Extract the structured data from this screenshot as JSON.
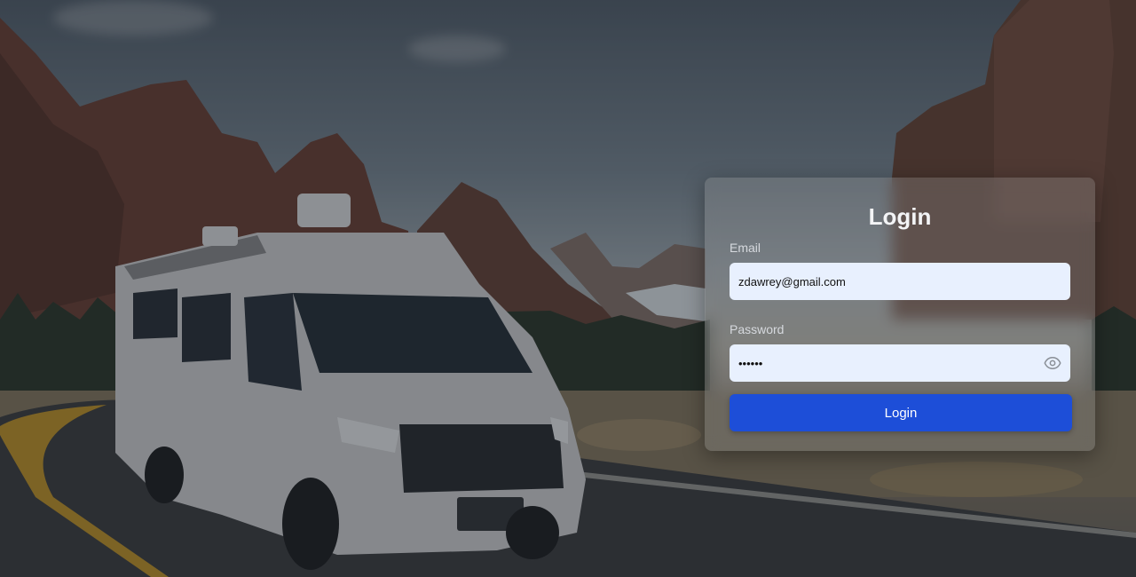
{
  "login": {
    "title": "Login",
    "email_label": "Email",
    "email_value": "zdawrey@gmail.com",
    "password_label": "Password",
    "password_value": "••••••",
    "submit_label": "Login",
    "toggle_icon": "eye-icon"
  },
  "colors": {
    "button": "#1d4ed8",
    "input_bg": "#e8f0fe"
  }
}
